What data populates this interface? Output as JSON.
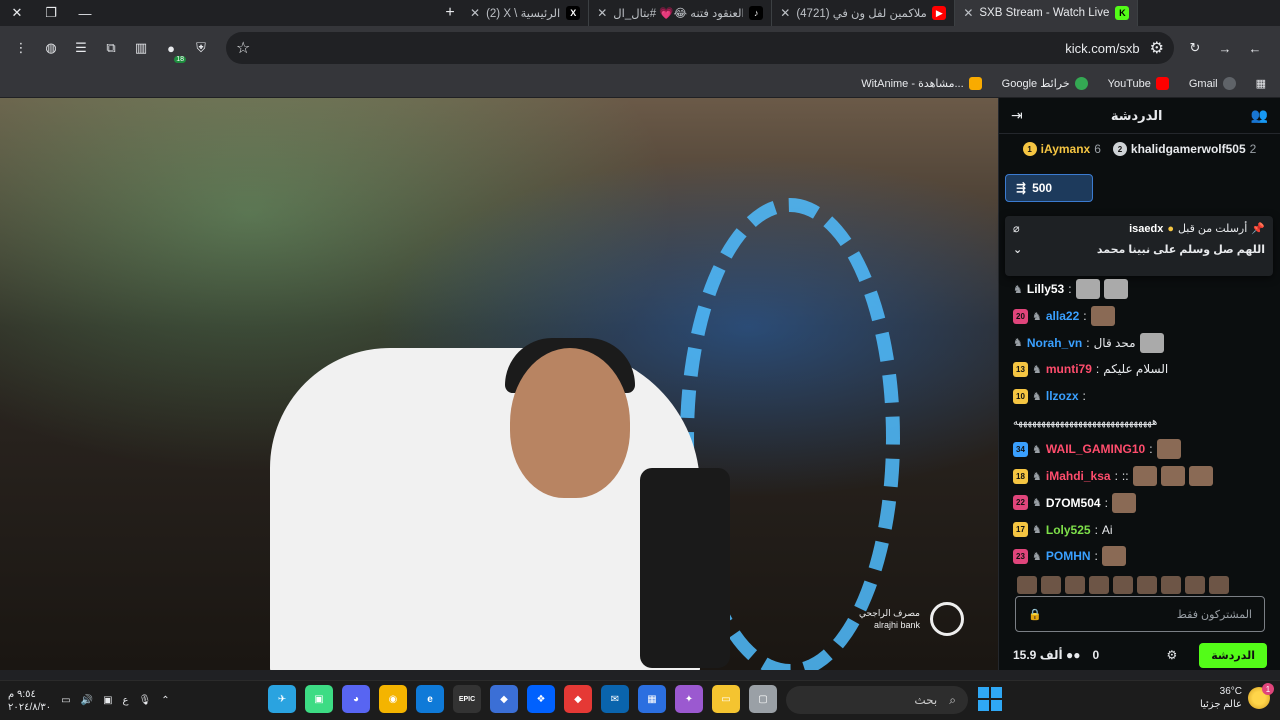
{
  "browser": {
    "tabs": [
      {
        "title": "SXB Stream - Watch Live on",
        "favicon_color": "#53fc18",
        "favicon_text": "K",
        "active": true
      },
      {
        "title": "(4721) ملاكمين لفل ون في IQB",
        "favicon_color": "#ff0000",
        "favicon_text": "▶"
      },
      {
        "title": "اخر العنقود فتنه 😂💗 #بتال_ال",
        "favicon_color": "#000000",
        "favicon_text": "♪"
      },
      {
        "title": "(2) X \\ الرئيسية",
        "favicon_color": "#000000",
        "favicon_text": "X"
      }
    ],
    "url": "kick.com/sxb",
    "extension_badge": "18",
    "bookmarks": [
      {
        "label": "Gmail",
        "color": "#5f6368"
      },
      {
        "label": "YouTube",
        "color": "#ff0000"
      },
      {
        "label": "Google خرائط",
        "color": "#34a853"
      },
      {
        "label": "WitAnime - مشاهدة...",
        "color": "#f9ab00"
      }
    ]
  },
  "video": {
    "sponsor_line1": "مصرف الراجحي",
    "sponsor_line2": "alrajhi bank"
  },
  "chat": {
    "title": "الدردشة",
    "leaderboard": [
      {
        "name": "khalidgamerwolf505",
        "count": "2",
        "rank": "2",
        "rank_color": "#cfd3d6"
      },
      {
        "name": "iAymanx",
        "count": "6",
        "rank": "1",
        "rank_color": "#f5c542"
      }
    ],
    "gift_amount": "500",
    "pinned": {
      "label": "أرسلت من قبل",
      "user": "isaedx",
      "message": "اللهم صل وسلم على نبينا محمد"
    },
    "messages": [
      {
        "badge": "",
        "badge_color": "",
        "user": "Lilly53",
        "user_color": "#ffffff",
        "text": ""
      },
      {
        "badge": "20",
        "badge_color": "#e0457b",
        "user": "alla22",
        "user_color": "#3aa0ff",
        "text": ""
      },
      {
        "badge": "",
        "badge_color": "",
        "user": "Norah_vn",
        "user_color": "#3aa0ff",
        "text": "محد قال"
      },
      {
        "badge": "13",
        "badge_color": "#f5c542",
        "user": "munti79",
        "user_color": "#ff4d6d",
        "text": "السلام عليكم"
      },
      {
        "badge": "10",
        "badge_color": "#f5c542",
        "user": "llzozx",
        "user_color": "#3aa0ff",
        "text": ""
      },
      {
        "badge": "",
        "badge_color": "",
        "user": "",
        "user_color": "#ffffff",
        "text": "ههههههههههههههههههههههههههههههه"
      },
      {
        "badge": "34",
        "badge_color": "#3aa0ff",
        "user": "WAIL_GAMING10",
        "user_color": "#ff4d6d",
        "text": ""
      },
      {
        "badge": "18",
        "badge_color": "#f5c542",
        "user": "iMahdi_ksa",
        "user_color": "#ff4d6d",
        "text": "::"
      },
      {
        "badge": "22",
        "badge_color": "#e0457b",
        "user": "D7OM504",
        "user_color": "#ffffff",
        "text": ""
      },
      {
        "badge": "17",
        "badge_color": "#f5c542",
        "user": "Loly525",
        "user_color": "#7ee04a",
        "text": "Ai"
      },
      {
        "badge": "23",
        "badge_color": "#e0457b",
        "user": "POMHN",
        "user_color": "#3aa0ff",
        "text": ""
      }
    ],
    "input_placeholder": "المشتركون فقط",
    "viewers": "15.9 ألف",
    "count": "0",
    "send_label": "الدردشة"
  },
  "taskbar": {
    "time": "٩:٥٤ م",
    "date": "٢٠٢٤/٨/٣٠",
    "lang": "ع",
    "search_placeholder": "بحث",
    "weather_temp": "36°C",
    "weather_desc": "عالم جزئيا",
    "notification_count": "1",
    "apps": [
      {
        "name": "telegram",
        "color": "#2aa3e0",
        "glyph": "✈"
      },
      {
        "name": "app-green",
        "color": "#3ddc84",
        "glyph": "▣"
      },
      {
        "name": "discord",
        "color": "#5865f2",
        "glyph": "◕"
      },
      {
        "name": "chrome",
        "color": "#f4b400",
        "glyph": "◉"
      },
      {
        "name": "edge",
        "color": "#0f7ad8",
        "glyph": "e"
      },
      {
        "name": "epic",
        "color": "#333333",
        "glyph": "EPIC"
      },
      {
        "name": "app-blue",
        "color": "#3b6fd6",
        "glyph": "◆"
      },
      {
        "name": "dropbox",
        "color": "#0061fe",
        "glyph": "❖"
      },
      {
        "name": "app-red",
        "color": "#e53935",
        "glyph": "◆"
      },
      {
        "name": "outlook",
        "color": "#0a64ad",
        "glyph": "✉"
      },
      {
        "name": "store",
        "color": "#2b6fe0",
        "glyph": "▦"
      },
      {
        "name": "copilot",
        "color": "#9b59d0",
        "glyph": "✦"
      },
      {
        "name": "files",
        "color": "#f4c430",
        "glyph": "▭"
      },
      {
        "name": "app-gray",
        "color": "#9aa0a6",
        "glyph": "▢"
      }
    ]
  }
}
